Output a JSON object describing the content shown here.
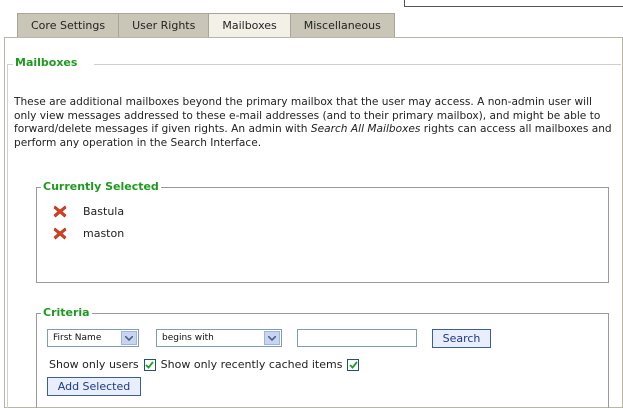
{
  "tabs": [
    {
      "label": "Core Settings",
      "active": false
    },
    {
      "label": "User Rights",
      "active": false
    },
    {
      "label": "Mailboxes",
      "active": true
    },
    {
      "label": "Miscellaneous",
      "active": false
    }
  ],
  "section": {
    "title": "Mailboxes",
    "desc_part1": "These are additional mailboxes beyond the primary mailbox that the user may access. A non-admin user will only view messages addressed to these e-mail addresses (and to their primary mailbox), and might be able to forward/delete messages if given rights. An admin with ",
    "desc_emphasis": "Search All Mailboxes",
    "desc_part2": " rights can access all mailboxes and perform any operation in the Search Interface."
  },
  "selected": {
    "title": "Currently Selected",
    "items": [
      "Bastula",
      "maston"
    ],
    "remove_icon": "red-x-icon"
  },
  "criteria": {
    "title": "Criteria",
    "field_value": "First Name",
    "operator_value": "begins with",
    "search_value": "",
    "search_button": "Search",
    "show_users_label": "Show only users",
    "show_users_checked": true,
    "show_cached_label": "Show only recently cached items",
    "show_cached_checked": true,
    "add_button": "Add Selected"
  },
  "colors": {
    "accent_green": "#1f9a1f",
    "tab_bg": "#c9c6b8",
    "tab_active_bg": "#f2f0e7",
    "button_border": "#3d5c9a",
    "remove_red": "#e0401a"
  }
}
